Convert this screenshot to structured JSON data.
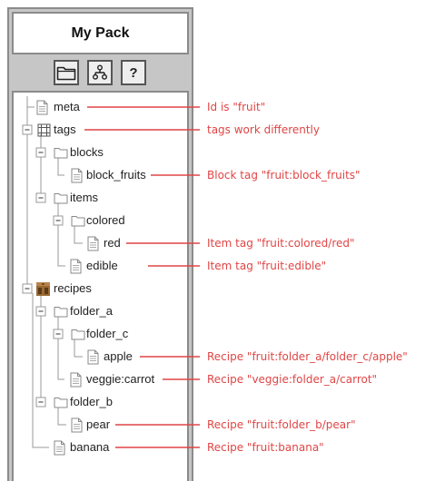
{
  "header": {
    "title": "My Pack"
  },
  "toolbar": {
    "folder_icon": "folder-icon",
    "tree_icon": "tree-icon",
    "help_label": "?"
  },
  "tree": {
    "meta": "meta",
    "tags": "tags",
    "blocks": "blocks",
    "block_fruits": "block_fruits",
    "items": "items",
    "colored": "colored",
    "red": "red",
    "edible": "edible",
    "recipes": "recipes",
    "folder_a": "folder_a",
    "folder_c": "folder_c",
    "apple": "apple",
    "veggie_carrot": "veggie:carrot",
    "folder_b": "folder_b",
    "pear": "pear",
    "banana": "banana"
  },
  "annotations": {
    "meta": "Id is \"fruit\"",
    "tags": "tags work differently",
    "block_fruits": "Block tag \"fruit:block_fruits\"",
    "red": "Item tag \"fruit:colored/red\"",
    "edible": "Item tag \"fruit:edible\"",
    "apple": "Recipe \"fruit:folder_a/folder_c/apple\"",
    "veggie_carrot": "Recipe \"veggie:folder_a/carrot\"",
    "pear": "Recipe \"fruit:folder_b/pear\"",
    "banana": "Recipe \"fruit:banana\""
  },
  "colors": {
    "panel": "#c6c6c6",
    "border": "#8b8b8b",
    "annotation": "#e04545",
    "tree_line": "#999999"
  }
}
